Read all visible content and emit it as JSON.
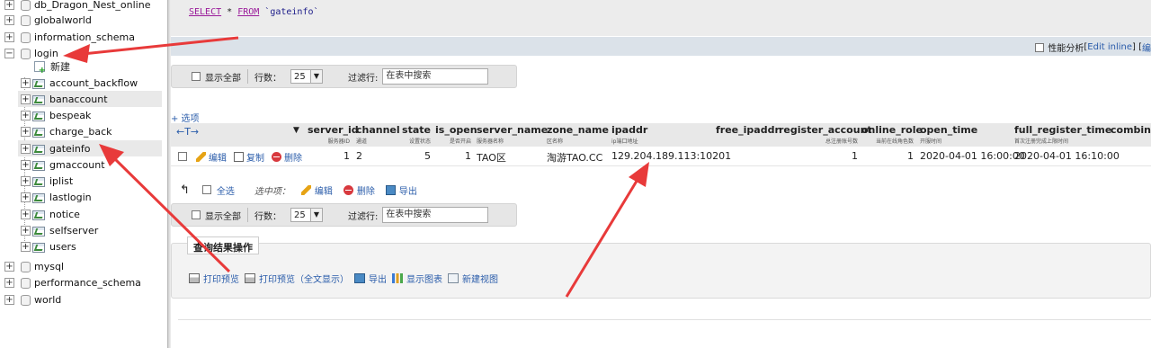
{
  "sidebar": {
    "databases_top": [
      {
        "name": "db_Dragon_Nest_online",
        "exp": "+"
      },
      {
        "name": "globalworld",
        "exp": "+"
      },
      {
        "name": "information_schema",
        "exp": "+"
      },
      {
        "name": "login",
        "exp": "−"
      }
    ],
    "new_label": "新建",
    "tables": [
      {
        "name": "account_backflow",
        "exp": "+"
      },
      {
        "name": "banaccount",
        "exp": "+"
      },
      {
        "name": "bespeak",
        "exp": "+"
      },
      {
        "name": "charge_back",
        "exp": "+"
      },
      {
        "name": "gateinfo",
        "exp": "+"
      },
      {
        "name": "gmaccount",
        "exp": "+"
      },
      {
        "name": "iplist",
        "exp": "+"
      },
      {
        "name": "lastlogin",
        "exp": "+"
      },
      {
        "name": "notice",
        "exp": "+"
      },
      {
        "name": "selfserver",
        "exp": "+"
      },
      {
        "name": "users",
        "exp": "+"
      }
    ],
    "databases_bottom": [
      {
        "name": "mysql",
        "exp": "+"
      },
      {
        "name": "performance_schema",
        "exp": "+"
      },
      {
        "name": "world",
        "exp": "+"
      }
    ]
  },
  "sql": {
    "keyword_select": "SELECT",
    "star": " * ",
    "keyword_from": "FROM",
    "table": " `gateinfo`"
  },
  "profile_bar": {
    "profiling": "性能分析",
    "edit_inline": "Edit inline",
    "bracket_open": " [",
    "bracket_mid": " ] [ ",
    "edit": "编"
  },
  "nav": {
    "show_all": "显示全部",
    "rows_label": "行数：",
    "rows_value": "25",
    "filter_label": "过滤行:",
    "filter_placeholder": "在表中搜索"
  },
  "options_link": "+ 选项",
  "table": {
    "arrows": "←T→",
    "sort_icon": "▼",
    "columns": [
      {
        "name": "server_id",
        "sub": "服务器ID"
      },
      {
        "name": "channel",
        "sub": "通道"
      },
      {
        "name": "state",
        "sub": "设置状态"
      },
      {
        "name": "is_open",
        "sub": "是否开启"
      },
      {
        "name": "server_name",
        "sub": "服务器名称"
      },
      {
        "name": "zone_name",
        "sub": "区名称"
      },
      {
        "name": "ipaddr",
        "sub": "ip端口地址"
      },
      {
        "name": "free_ipaddr",
        "sub": ""
      },
      {
        "name": "register_account",
        "sub": "总注册账号数"
      },
      {
        "name": "online_role",
        "sub": "当前在线角色数"
      },
      {
        "name": "open_time",
        "sub": "开服时间"
      },
      {
        "name": "full_register_time",
        "sub": "首次注册完成上限时间"
      },
      {
        "name": "combine_",
        "sub": ""
      }
    ],
    "row_actions": {
      "edit": "编辑",
      "copy": "复制",
      "delete": "删除"
    },
    "row": {
      "server_id": "1",
      "channel": "2",
      "state": "5",
      "is_open": "1",
      "server_name": "TAO区",
      "zone_name": "淘游TAO.CC",
      "ipaddr": "129.204.189.113:10201",
      "free_ipaddr": "",
      "register_account": "1",
      "online_role": "1",
      "open_time": "2020-04-01 16:00:00",
      "full_register_time": "2020-04-01 16:10:00"
    }
  },
  "with_selected": {
    "check_all": "全选",
    "label": "选中项：",
    "edit": "编辑",
    "delete": "删除",
    "export": "导出"
  },
  "query_ops": {
    "title": "查询结果操作",
    "print": "打印预览",
    "print_full": "打印预览（全文显示）",
    "export": "导出",
    "chart": "显示图表",
    "view": "新建视图"
  },
  "colors": {
    "link": "#2a5caa",
    "annotation_arrow": "#e83a3a",
    "keyword": "#9a1a9a"
  }
}
